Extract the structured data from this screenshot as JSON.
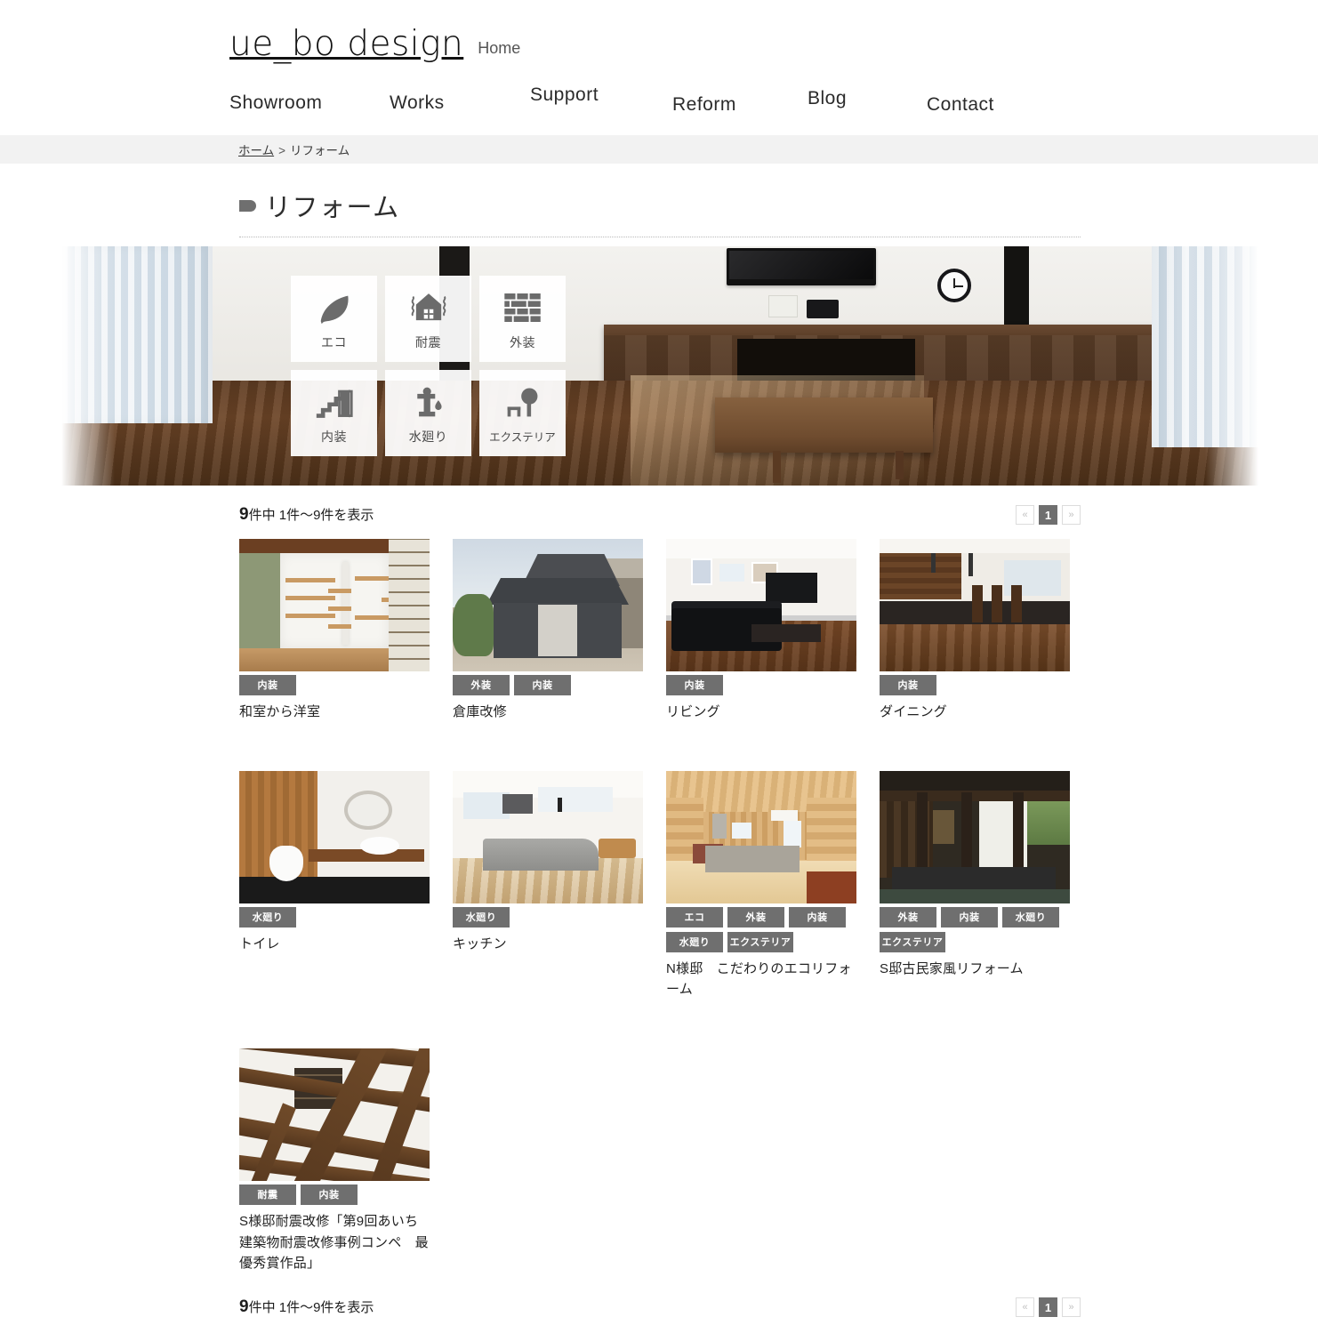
{
  "header": {
    "brand": "ue_bo design",
    "home_label": "Home",
    "nav": [
      {
        "label": "Showroom",
        "name": "showroom"
      },
      {
        "label": "Works",
        "name": "works"
      },
      {
        "label": "Support",
        "name": "support"
      },
      {
        "label": "Reform",
        "name": "reform"
      },
      {
        "label": "Blog",
        "name": "blog"
      },
      {
        "label": "Contact",
        "name": "contact"
      }
    ]
  },
  "breadcrumb": {
    "home": "ホーム",
    "separator": ">",
    "current": "リフォーム"
  },
  "page_title": "リフォーム",
  "categories": [
    {
      "label": "エコ",
      "icon": "leaf-icon"
    },
    {
      "label": "耐震",
      "icon": "house-quake-icon"
    },
    {
      "label": "外装",
      "icon": "brick-wall-icon"
    },
    {
      "label": "内装",
      "icon": "stairs-door-icon"
    },
    {
      "label": "水廻り",
      "icon": "faucet-icon"
    },
    {
      "label": "エクステリア",
      "icon": "tree-fence-icon"
    }
  ],
  "result_bar": {
    "count": "9",
    "count_suffix": "件中 1件〜9件を表示"
  },
  "pagination": {
    "prev": "«",
    "current": "1",
    "next": "»"
  },
  "items": [
    {
      "title": "和室から洋室",
      "tags": [
        "内装"
      ],
      "thumb": "closet-shelves-photo"
    },
    {
      "title": "倉庫改修",
      "tags": [
        "外装",
        "内装"
      ],
      "thumb": "warehouse-exterior-photo"
    },
    {
      "title": "リビング",
      "tags": [
        "内装"
      ],
      "thumb": "living-room-photo"
    },
    {
      "title": "ダイニング",
      "tags": [
        "内装"
      ],
      "thumb": "dining-room-photo"
    },
    {
      "title": "トイレ",
      "tags": [
        "水廻り"
      ],
      "thumb": "toilet-photo"
    },
    {
      "title": "キッチン",
      "tags": [
        "水廻り"
      ],
      "thumb": "kitchen-photo"
    },
    {
      "title": "N様邸　こだわりのエコリフォーム",
      "tags": [
        "エコ",
        "外装",
        "内装",
        "水廻り",
        "エクステリア"
      ],
      "thumb": "wood-interior-photo"
    },
    {
      "title": "S邸古民家風リフォーム",
      "tags": [
        "外装",
        "内装",
        "水廻り",
        "エクステリア"
      ],
      "thumb": "old-house-exterior-photo"
    },
    {
      "title": "S様邸耐震改修「第9回あいち建築物耐震改修事例コンペ　最優秀賞作品」",
      "tags": [
        "耐震",
        "内装"
      ],
      "thumb": "ceiling-beams-photo"
    }
  ],
  "colors": {
    "tag_bg": "#6f6f6f",
    "pager_active_bg": "#6f6f6f",
    "breadcrumb_bg": "#f2f2f2",
    "text": "#333333"
  }
}
